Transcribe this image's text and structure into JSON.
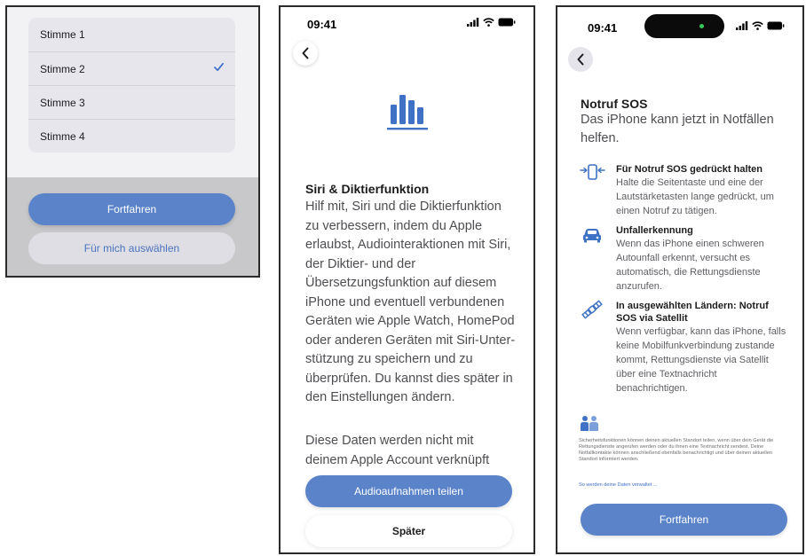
{
  "colors": {
    "accent": "#5a83c9",
    "link": "#3b6fc9",
    "check": "#3b6fc9"
  },
  "voice_picker": {
    "voices": [
      {
        "label": "Stimme 1",
        "selected": false
      },
      {
        "label": "Stimme 2",
        "selected": true
      },
      {
        "label": "Stimme 3",
        "selected": false
      },
      {
        "label": "Stimme 4",
        "selected": false
      }
    ],
    "continue_label": "Fortfahren",
    "choose_for_me_label": "Für mich auswählen"
  },
  "siri_screen": {
    "status_time": "09:41",
    "icons": [
      "chevron-left-icon",
      "audio-bars-icon",
      "signal-icon",
      "wifi-icon",
      "battery-icon"
    ],
    "title": "Siri & Diktierfunktion",
    "body": "Hilf mit, Siri und die Diktierfunk­tion zu verbessern, indem du Apple erlaubst, Audiointeraktio­nen mit Siri, der Diktier- und der Übersetzungsfunktion auf diesem iPhone und eventuell verbundenen Geräten wie Apple Watch, HomePod oder anderen Geräten mit Siri-Unter­stützung zu speichern und zu überprüfen. Du kannst dies spä­ter in den Einstellungen ändern.",
    "body2": "Diese Daten werden nicht mit deinem Apple Account verknüpft",
    "share_label": "Audioaufnahmen teilen",
    "later_label": "Später"
  },
  "sos_screen": {
    "status_time": "09:41",
    "title": "Notruf SOS",
    "subtitle": "Das iPhone kann jetzt in Notfällen helfen.",
    "features": [
      {
        "icon": "side-button-icon",
        "heading": "Für Notruf SOS gedrückt halten",
        "text": "Halte die Seitentaste und eine der Lautstärketasten lange gedrückt, um einen Notruf zu tätigen."
      },
      {
        "icon": "car-icon",
        "heading": "Unfallerkennung",
        "text": "Wenn das iPhone einen schweren Autounfall erkennt, versucht es automatisch, die Rettungsdienste anzurufen."
      },
      {
        "icon": "satellite-icon",
        "heading": "In ausgewählten Ländern: Notruf SOS via Satellit",
        "text": "Wenn verfügbar, kann das iPhone, falls keine Mobilfunkverbindung zustande kommt, Rettungsdienste via Satellit über eine Textnachricht benachrichtigen."
      }
    ],
    "privacy_icon": "privacy-handshake-icon",
    "privacy_text": "Sicherheitsfunktionen können deinen aktuellen Standort teilen, wenn über dein Gerät die Rettungsdienste angerufen werden oder du ihnen eine Textnachricht sendest. Deine Notfallkontakte können anschließend ebenfalls benachrichtigt und über deinen aktuellen Standort informiert werden.",
    "privacy_link": "So werden deine Daten verwaltet ...",
    "continue_label": "Fortfahren"
  }
}
